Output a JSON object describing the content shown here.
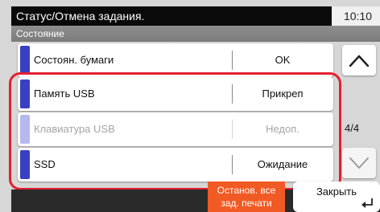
{
  "header": {
    "title": "Статус/Отмена задания.",
    "time": "10:10",
    "subtitle": "Состояние"
  },
  "devices": [
    {
      "name": "Состоян. бумаги",
      "status": "OK",
      "enabled": true
    },
    {
      "name": "Память USB",
      "status": "Прикреп",
      "enabled": true
    },
    {
      "name": "Клавиатура USB",
      "status": "Недоп.",
      "enabled": false
    },
    {
      "name": "SSD",
      "status": "Ожидание",
      "enabled": true
    }
  ],
  "pagination": {
    "indicator": "4/4"
  },
  "footer": {
    "stop_all_label": "Останов. все зад. печати",
    "close_label": "Закрыть"
  },
  "colors": {
    "accent": "#3a3fc2",
    "highlight": "#e3202f",
    "stop_button": "#f15a24"
  },
  "icons": {
    "scroll_up": "chevron-up-icon",
    "scroll_down": "chevron-down-icon",
    "close": "enter-icon"
  }
}
